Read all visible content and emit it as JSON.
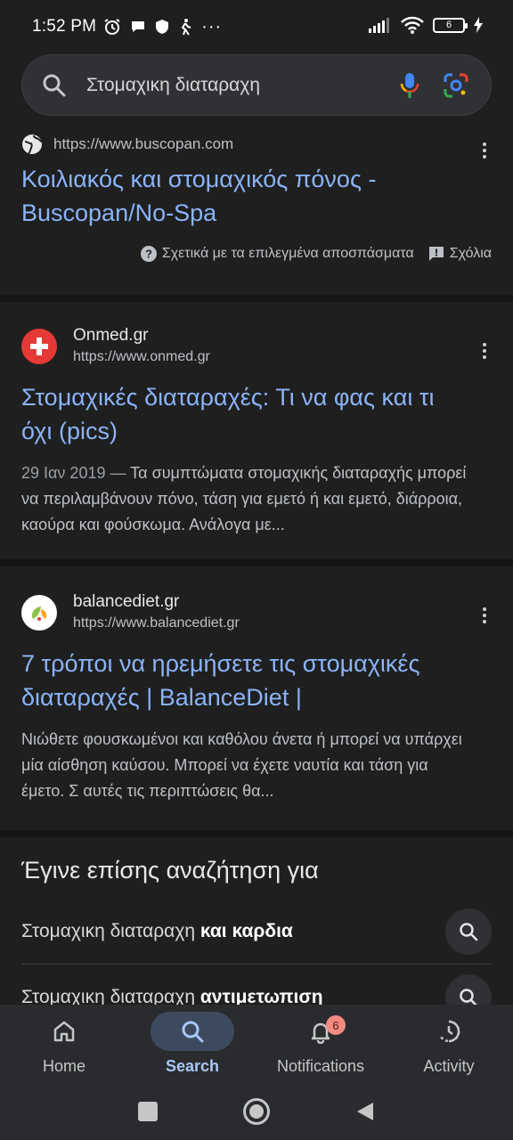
{
  "status_bar": {
    "time": "1:52 PM",
    "battery": "6"
  },
  "search": {
    "query": "Στομαχικη διαταραχη",
    "search_icon": "search-icon",
    "mic_icon": "mic-icon",
    "lens_icon": "lens-icon"
  },
  "results": [
    {
      "url": "https://www.buscopan.com",
      "title": "Κοιλιακός και στομαχικός πόνος - Buscopan/No-Spa",
      "about_label": "Σχετικά με τα επιλεγμένα αποσπάσματα",
      "feedback_label": "Σχόλια"
    },
    {
      "site": "Onmed.gr",
      "url": "https://www.onmed.gr",
      "title": "Στομαχικές διαταραχές: Τι να φας και τι όχι (pics)",
      "date": "29 Ιαν 2019 — ",
      "snippet": "Τα συμπτώματα στομαχικής διαταραχής μπορεί να περιλαμβάνουν πόνο, τάση για εμετό ή και εμετό, διάρροια, καούρα και φούσκωμα. Ανάλογα με..."
    },
    {
      "site": "balancediet.gr",
      "url": "https://www.balancediet.gr",
      "title": "7 τρόποι να ηρεμήσετε τις στομαχικές διαταραχές | BalanceDiet |",
      "snippet": "Νιώθετε φουσκωμένοι και καθόλου άνετα ή μπορεί να υπάρχει μία αίσθηση καύσου. Μπορεί να έχετε ναυτία και τάση για έμετο. Σ αυτές τις περιπτώσεις θα..."
    }
  ],
  "related": {
    "heading": "Έγινε επίσης αναζήτηση για",
    "items": [
      {
        "prefix": "Στομαχικη διαταραχη ",
        "bold": "και καρδια"
      },
      {
        "prefix": "Στομαχικη διαταραχη ",
        "bold": "αντιμετωπιση"
      }
    ]
  },
  "bottom_nav": {
    "items": [
      {
        "label": "Home",
        "icon": "home-icon"
      },
      {
        "label": "Search",
        "icon": "search-icon"
      },
      {
        "label": "Notifications",
        "icon": "bell-icon",
        "badge": "6"
      },
      {
        "label": "Activity",
        "icon": "activity-icon"
      }
    ],
    "active": "Search"
  },
  "colors": {
    "link": "#8ab4f8",
    "background": "#1f1f1f",
    "badge": "#f28b82"
  }
}
